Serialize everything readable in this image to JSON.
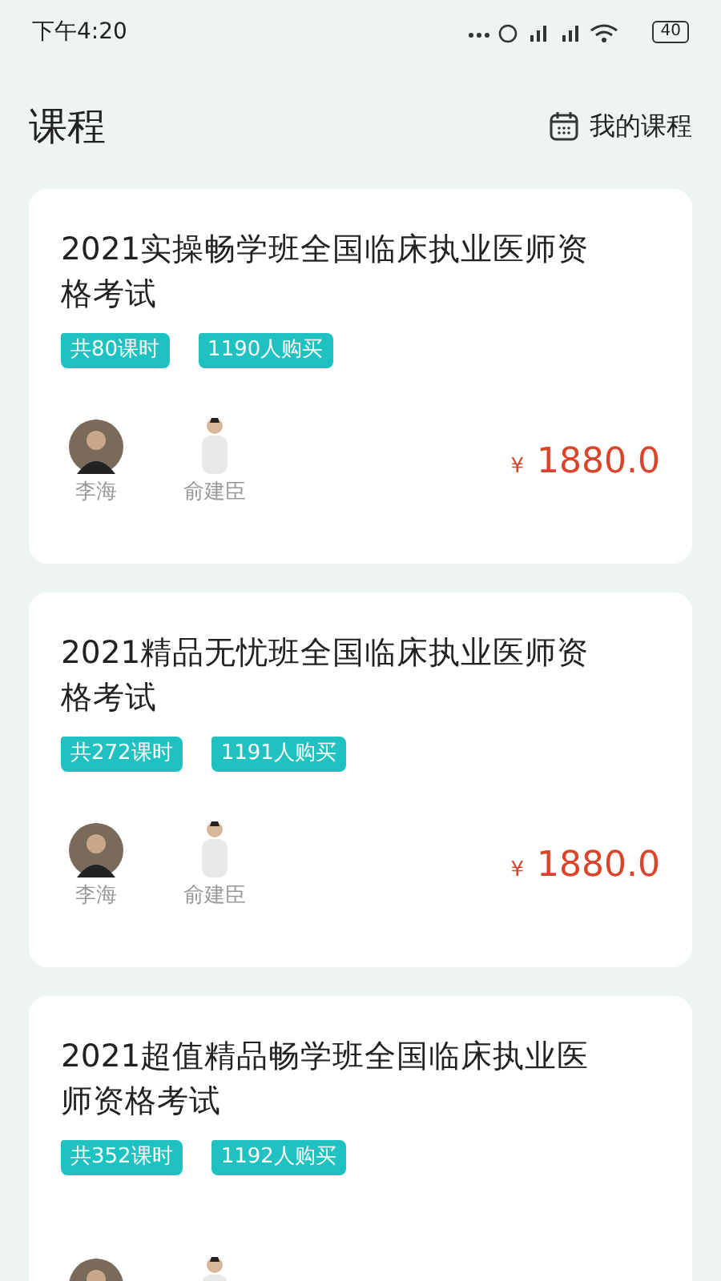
{
  "status_bar": {
    "time": "下午4:20",
    "battery": "40"
  },
  "header": {
    "title": "课程",
    "my_courses": "我的课程"
  },
  "courses": [
    {
      "title": "2021实操畅学班全国临床执业医师资格考试",
      "tags": [
        "共80课时",
        "1190人购买"
      ],
      "teachers": [
        {
          "name": "李海",
          "kind": "round"
        },
        {
          "name": "俞建臣",
          "kind": "standing"
        }
      ],
      "currency": "¥",
      "price": "1880.0"
    },
    {
      "title": "2021精品无忧班全国临床执业医师资格考试",
      "tags": [
        "共272课时",
        "1191人购买"
      ],
      "teachers": [
        {
          "name": "李海",
          "kind": "round"
        },
        {
          "name": "俞建臣",
          "kind": "standing"
        }
      ],
      "currency": "¥",
      "price": "1880.0"
    },
    {
      "title": "2021超值精品畅学班全国临床执业医师资格考试",
      "tags": [
        "共352课时",
        "1192人购买"
      ],
      "teachers": [
        {
          "kind": "round"
        },
        {
          "kind": "standing"
        }
      ]
    }
  ]
}
